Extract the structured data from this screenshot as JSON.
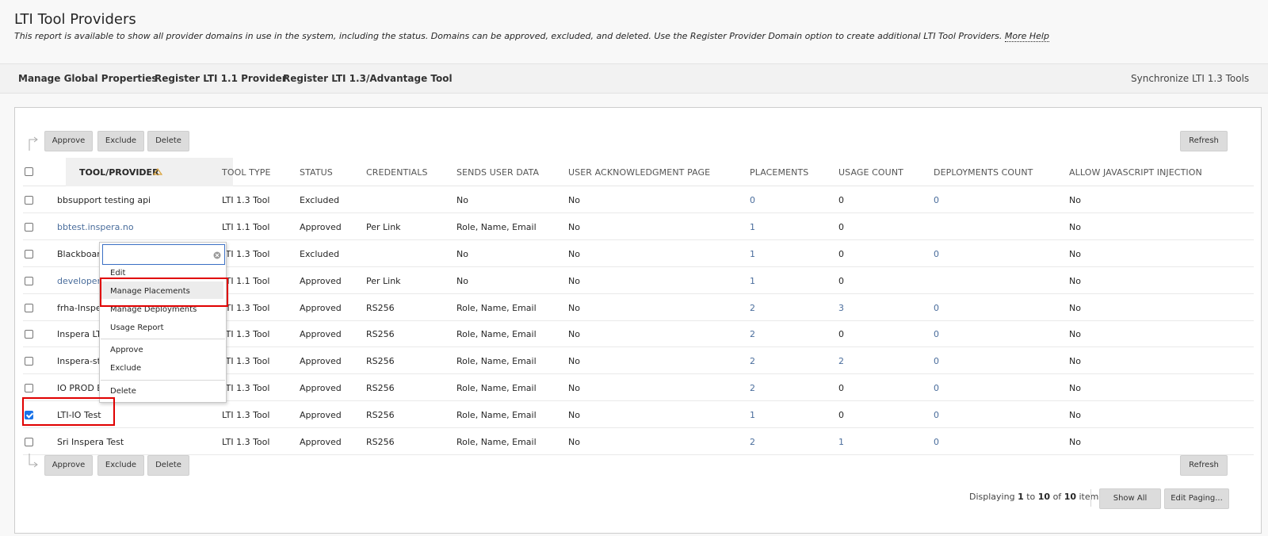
{
  "header": {
    "title": "LTI Tool Providers",
    "description": "This report is available to show all provider domains in use in the system, including the status. Domains can be approved, excluded, and deleted. Use the Register Provider Domain option to create additional LTI Tool Providers.",
    "more_help": "More Help"
  },
  "action_bar": {
    "manage_global": "Manage Global Properties",
    "register_11": "Register LTI 1.1 Provider",
    "register_13": "Register LTI 1.3/Advantage Tool",
    "synchronize": "Synchronize LTI 1.3 Tools"
  },
  "toolbar": {
    "approve": "Approve",
    "exclude": "Exclude",
    "delete": "Delete",
    "refresh": "Refresh"
  },
  "columns": {
    "tool_provider": "TOOL/PROVIDER",
    "tool_type": "TOOL TYPE",
    "status": "STATUS",
    "credentials": "CREDENTIALS",
    "sends_user_data": "SENDS USER DATA",
    "user_ack_page": "USER ACKNOWLEDGMENT PAGE",
    "placements": "PLACEMENTS",
    "usage_count": "USAGE COUNT",
    "deployments_count": "DEPLOYMENTS COUNT",
    "allow_js": "ALLOW JAVASCRIPT INJECTION"
  },
  "rows": [
    {
      "name": "bbsupport testing api",
      "type": "LTI 1.3 Tool",
      "status": "Excluded",
      "cred": "",
      "sends": "No",
      "ack": "No",
      "placements": "0",
      "usage": "0",
      "deployments": "0",
      "js": "No"
    },
    {
      "name": "bbtest.inspera.no",
      "type": "LTI 1.1 Tool",
      "status": "Approved",
      "cred": "Per Link",
      "sends": "Role, Name, Email",
      "ack": "No",
      "placements": "1",
      "usage": "0",
      "deployments": "",
      "js": "No"
    },
    {
      "name": "Blackboard",
      "type": "LTI 1.3 Tool",
      "status": "Excluded",
      "cred": "",
      "sends": "No",
      "ack": "No",
      "placements": "1",
      "usage": "0",
      "deployments": "0",
      "js": "No"
    },
    {
      "name": "developer.",
      "type": "LTI 1.1 Tool",
      "status": "Approved",
      "cred": "Per Link",
      "sends": "No",
      "ack": "No",
      "placements": "1",
      "usage": "0",
      "deployments": "",
      "js": "No"
    },
    {
      "name": "frha-Inspe",
      "type": "LTI 1.3 Tool",
      "status": "Approved",
      "cred": "RS256",
      "sends": "Role, Name, Email",
      "ack": "No",
      "placements": "2",
      "usage": "3",
      "deployments": "0",
      "js": "No"
    },
    {
      "name": "Inspera LTI",
      "type": "LTI 1.3 Tool",
      "status": "Approved",
      "cred": "RS256",
      "sends": "Role, Name, Email",
      "ack": "No",
      "placements": "2",
      "usage": "0",
      "deployments": "0",
      "js": "No"
    },
    {
      "name": "Inspera-sta",
      "type": "LTI 1.3 Tool",
      "status": "Approved",
      "cred": "RS256",
      "sends": "Role, Name, Email",
      "ack": "No",
      "placements": "2",
      "usage": "2",
      "deployments": "0",
      "js": "No"
    },
    {
      "name": "IO PROD B",
      "type": "LTI 1.3 Tool",
      "status": "Approved",
      "cred": "RS256",
      "sends": "Role, Name, Email",
      "ack": "No",
      "placements": "2",
      "usage": "0",
      "deployments": "0",
      "js": "No"
    },
    {
      "name": "LTI-IO Test",
      "type": "LTI 1.3 Tool",
      "status": "Approved",
      "cred": "RS256",
      "sends": "Role, Name, Email",
      "ack": "No",
      "placements": "1",
      "usage": "0",
      "deployments": "0",
      "js": "No"
    },
    {
      "name": "Sri Inspera Test",
      "type": "LTI 1.3 Tool",
      "status": "Approved",
      "cred": "RS256",
      "sends": "Role, Name, Email",
      "ack": "No",
      "placements": "2",
      "usage": "1",
      "deployments": "0",
      "js": "No"
    }
  ],
  "context_menu": {
    "search_value": "",
    "edit": "Edit",
    "manage_placements": "Manage Placements",
    "manage_deployments": "Manage Deployments",
    "usage_report": "Usage Report",
    "approve": "Approve",
    "exclude": "Exclude",
    "delete": "Delete"
  },
  "footer": {
    "displaying": "Displaying",
    "from": "1",
    "to_word": "to",
    "to": "10",
    "of_word": "of",
    "total": "10",
    "items_word": "items",
    "show_all": "Show All",
    "edit_paging": "Edit Paging..."
  },
  "colors": {
    "link": "#4a6d9c",
    "highlight_box": "#e00000",
    "checkbox_checked": "#1a73e8"
  }
}
